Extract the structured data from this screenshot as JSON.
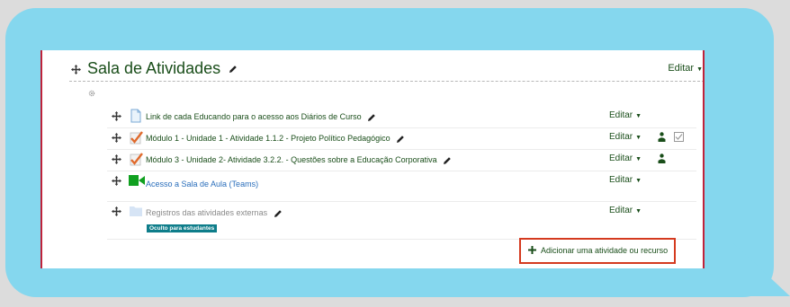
{
  "section": {
    "title": "Sala de Atividades",
    "edit_label": "Editar"
  },
  "activities": [
    {
      "label": "Link de cada Educando para o acesso aos Diários de Curso",
      "icon": "url-file-icon",
      "edit_label": "Editar",
      "editable_name": true
    },
    {
      "label": "Módulo 1 - Unidade 1 - Atividade 1.1.2 - Projeto Político Pedagógico",
      "icon": "assignment-check-icon",
      "edit_label": "Editar",
      "editable_name": true
    },
    {
      "label": "Módulo 3 - Unidade 2- Atividade 3.2.2. - Questões sobre a Educação Corporativa",
      "icon": "assignment-check-icon",
      "edit_label": "Editar",
      "editable_name": true
    },
    {
      "label": "Acesso a Sala de Aula (Teams)",
      "icon": "video-camera-icon",
      "edit_label": "Editar",
      "editable_name": false
    },
    {
      "label": "Registros das atividades externas",
      "icon": "folder-icon",
      "edit_label": "Editar",
      "editable_name": true
    }
  ],
  "hidden_badge": "Oculto para estudantes",
  "add_button": {
    "label": "Adicionar uma atividade ou recurso"
  },
  "colors": {
    "bubble": "#85d7ee",
    "accent_green": "#1a4e1a",
    "badge": "#0e7d8a",
    "highlight_border": "#d43a1f",
    "card_border": "#c0233a"
  }
}
